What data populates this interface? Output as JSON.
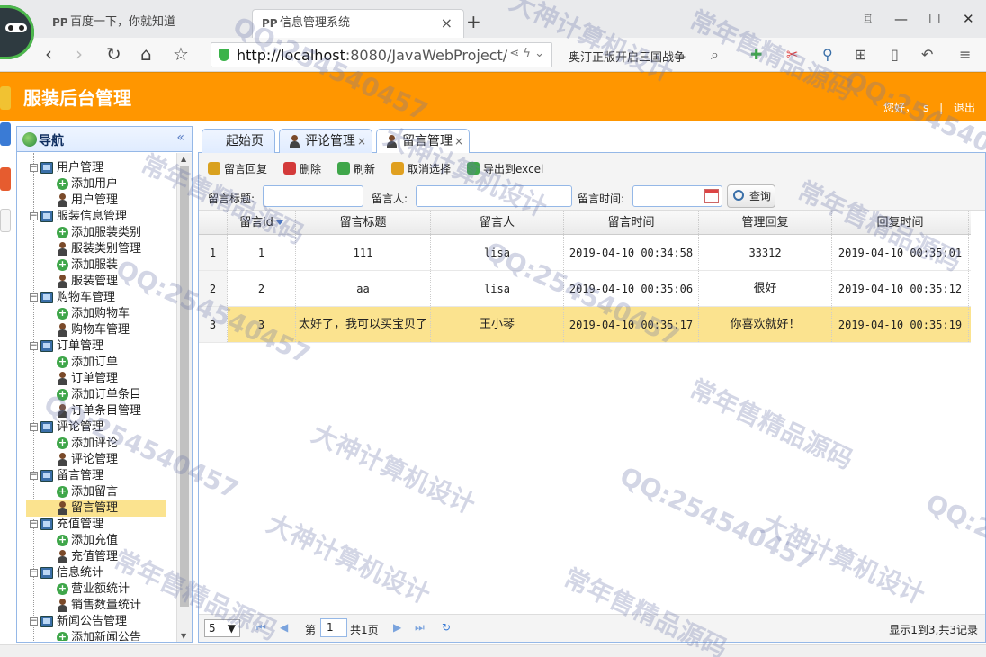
{
  "browser": {
    "tabs": [
      {
        "icon": "PP",
        "title": "百度一下，你就知道"
      },
      {
        "icon": "PP",
        "title": "信息管理系统"
      }
    ],
    "new_tab": "+",
    "url_host": "http://localhost",
    "url_rest": ":8080/JavaWebProject/",
    "search_suggest": "奥汀正版开启三国战争"
  },
  "app": {
    "title": "服装后台管理",
    "greeting": "您好，",
    "username": "s",
    "separator": "|",
    "logout": "退出"
  },
  "nav": {
    "title": "导航",
    "collapse": "«",
    "groups": [
      {
        "label": "用户管理",
        "items": [
          {
            "icon": "add",
            "label": "添加用户"
          },
          {
            "icon": "user",
            "label": "用户管理"
          }
        ]
      },
      {
        "label": "服装信息管理",
        "items": [
          {
            "icon": "add",
            "label": "添加服装类别"
          },
          {
            "icon": "user",
            "label": "服装类别管理"
          },
          {
            "icon": "add",
            "label": "添加服装"
          },
          {
            "icon": "user",
            "label": "服装管理"
          }
        ]
      },
      {
        "label": "购物车管理",
        "items": [
          {
            "icon": "add",
            "label": "添加购物车"
          },
          {
            "icon": "user",
            "label": "购物车管理"
          }
        ]
      },
      {
        "label": "订单管理",
        "items": [
          {
            "icon": "add",
            "label": "添加订单"
          },
          {
            "icon": "user",
            "label": "订单管理"
          },
          {
            "icon": "add",
            "label": "添加订单条目"
          },
          {
            "icon": "user",
            "label": "订单条目管理"
          }
        ]
      },
      {
        "label": "评论管理",
        "items": [
          {
            "icon": "add",
            "label": "添加评论"
          },
          {
            "icon": "user",
            "label": "评论管理"
          }
        ]
      },
      {
        "label": "留言管理",
        "items": [
          {
            "icon": "add",
            "label": "添加留言"
          },
          {
            "icon": "user",
            "label": "留言管理",
            "selected": true
          }
        ]
      },
      {
        "label": "充值管理",
        "items": [
          {
            "icon": "add",
            "label": "添加充值"
          },
          {
            "icon": "user",
            "label": "充值管理"
          }
        ]
      },
      {
        "label": "信息统计",
        "items": [
          {
            "icon": "add",
            "label": "营业额统计"
          },
          {
            "icon": "user",
            "label": "销售数量统计"
          }
        ]
      },
      {
        "label": "新闻公告管理",
        "items": [
          {
            "icon": "add",
            "label": "添加新闻公告"
          }
        ]
      }
    ]
  },
  "content_tabs": [
    {
      "label": "起始页",
      "closable": false
    },
    {
      "label": "评论管理",
      "closable": true
    },
    {
      "label": "留言管理",
      "closable": true,
      "active": true
    }
  ],
  "toolbar": [
    {
      "icon": "edit-icon",
      "color": "#d9a11f",
      "label": "留言回复"
    },
    {
      "icon": "delete-icon",
      "color": "#d33a3a",
      "label": "删除"
    },
    {
      "icon": "refresh-icon",
      "color": "#3fa64a",
      "label": "刷新"
    },
    {
      "icon": "undo-icon",
      "color": "#e0a020",
      "label": "取消选择"
    },
    {
      "icon": "export-icon",
      "color": "#3fa64a",
      "label": "导出到excel"
    }
  ],
  "search": {
    "title_label": "留言标题:",
    "person_label": "留言人:",
    "time_label": "留言时间:",
    "query_button": "查询"
  },
  "grid": {
    "columns": [
      "留言id",
      "留言标题",
      "留言人",
      "留言时间",
      "管理回复",
      "回复时间"
    ],
    "rows": [
      {
        "rn": "1",
        "id": "1",
        "title": "111",
        "person": "lisa",
        "time": "2019-04-10 00:34:58",
        "reply": "33312",
        "reply_time": "2019-04-10 00:35:01"
      },
      {
        "rn": "2",
        "id": "2",
        "title": "aa",
        "person": "lisa",
        "time": "2019-04-10 00:35:06",
        "reply": "很好",
        "reply_time": "2019-04-10 00:35:12"
      },
      {
        "rn": "3",
        "id": "3",
        "title": "太好了，我可以买宝贝了",
        "person": "王小琴",
        "time": "2019-04-10 00:35:17",
        "reply": "你喜欢就好！",
        "reply_time": "2019-04-10 00:35:19"
      }
    ],
    "selected_row": 2
  },
  "pager": {
    "page_size": "5",
    "page_prefix": "第",
    "page_number": "1",
    "page_total": "共1页",
    "info": "显示1到3,共3记录"
  },
  "watermarks": [
    "QQ:254540457",
    "常年售精品源码",
    "大神计算机设计"
  ]
}
